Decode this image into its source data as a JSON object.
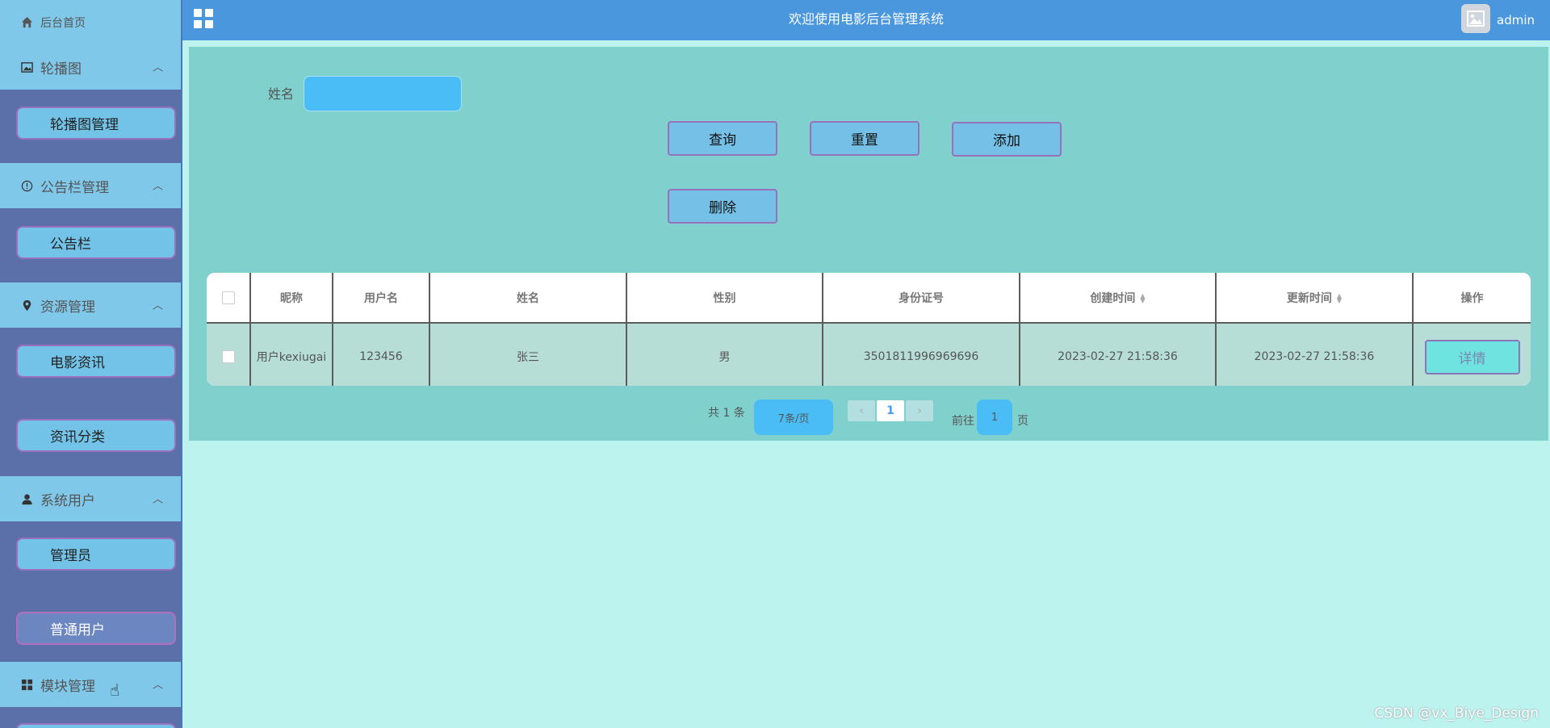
{
  "sidebar": {
    "home": "后台首页",
    "groups": [
      {
        "title": "轮播图",
        "icon": "image-icon",
        "items": [
          "轮播图管理"
        ]
      },
      {
        "title": "公告栏管理",
        "icon": "info-icon",
        "items": [
          "公告栏"
        ]
      },
      {
        "title": "资源管理",
        "icon": "location-icon",
        "items": [
          "电影资讯",
          "资讯分类"
        ]
      },
      {
        "title": "系统用户",
        "icon": "user-icon",
        "items": [
          "管理员",
          "普通用户"
        ]
      },
      {
        "title": "模块管理",
        "icon": "grid-icon",
        "items": []
      }
    ]
  },
  "topbar": {
    "title": "欢迎使用电影后台管理系统",
    "user": "admin"
  },
  "search": {
    "name_label": "姓名",
    "name_value": "",
    "query_btn": "查询",
    "reset_btn": "重置",
    "add_btn": "添加",
    "delete_btn": "删除"
  },
  "table": {
    "headers": [
      "昵称",
      "用户名",
      "姓名",
      "性别",
      "身份证号",
      "创建时间",
      "更新时间",
      "操作"
    ],
    "rows": [
      {
        "nickname": "用户kexiugai",
        "username": "123456",
        "name": "张三",
        "gender": "男",
        "id_number": "3501811996969696",
        "created": "2023-02-27 21:58:36",
        "updated": "2023-02-27 21:58:36",
        "action": "详情"
      }
    ]
  },
  "pagination": {
    "total": "共 1 条",
    "page_size": "7条/页",
    "current": "1",
    "goto_label": "前往",
    "goto_value": "1",
    "page_suffix": "页",
    "prev": "‹",
    "next": "›"
  },
  "watermark": "CSDN @vx_Biye_Design"
}
